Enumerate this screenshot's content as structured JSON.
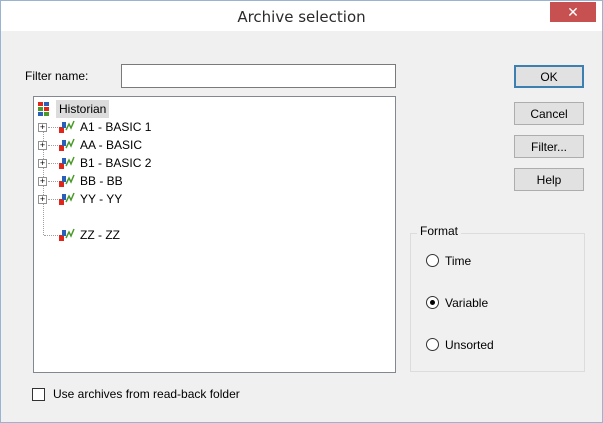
{
  "window": {
    "title": "Archive selection",
    "close_glyph": "✕"
  },
  "filter": {
    "label": "Filter name:",
    "value": ""
  },
  "tree": {
    "root": {
      "label": "Historian",
      "icon": "historian-icon"
    },
    "items": [
      {
        "label": "A1 - BASIC 1",
        "expandable": true,
        "icon": "archive-icon"
      },
      {
        "label": "AA - BASIC",
        "expandable": true,
        "icon": "archive-icon"
      },
      {
        "label": "B1 - BASIC 2",
        "expandable": true,
        "icon": "archive-icon"
      },
      {
        "label": "BB - BB",
        "expandable": true,
        "icon": "archive-icon"
      },
      {
        "label": "YY - YY",
        "expandable": true,
        "icon": "archive-icon"
      },
      {
        "label": "ZZ - ZZ",
        "expandable": false,
        "icon": "archive-icon"
      }
    ]
  },
  "buttons": {
    "ok": "OK",
    "cancel": "Cancel",
    "filter": "Filter...",
    "help": "Help"
  },
  "format": {
    "title": "Format",
    "options": [
      {
        "label": "Time",
        "checked": false
      },
      {
        "label": "Variable",
        "checked": true
      },
      {
        "label": "Unsorted",
        "checked": false
      }
    ]
  },
  "readback": {
    "label": "Use archives from read-back folder",
    "checked": false
  },
  "colors": {
    "accent": "#3c7fb1",
    "close": "#c75050",
    "selected_row": "#dcdcdc"
  }
}
